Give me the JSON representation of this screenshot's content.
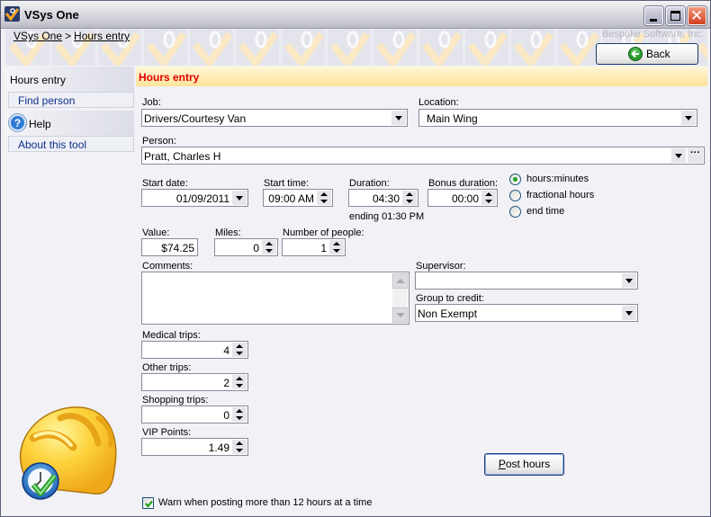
{
  "window": {
    "title": "VSys One",
    "controls": [
      "minimize",
      "maximize",
      "close"
    ]
  },
  "banner": {
    "breadcrumb": [
      {
        "label": "VSys One"
      },
      {
        "label": "Hours entry"
      }
    ],
    "breadcrumb_separator": ">",
    "company": "Bespoke Software, Inc.",
    "back_label": "Back"
  },
  "sidebar": {
    "section1_title": "Hours entry",
    "section1_link": "Find person",
    "section2_title": "Help",
    "section2_link": "About this tool"
  },
  "section": {
    "title": "Hours entry",
    "title_color": "#e00000"
  },
  "form": {
    "job": {
      "label": "Job:",
      "value": "Drivers/Courtesy Van"
    },
    "location": {
      "label": "Location:",
      "value": "Main Wing"
    },
    "person": {
      "label": "Person:",
      "value": "Pratt, Charles H"
    },
    "start_date": {
      "label": "Start date:",
      "value": "01/09/2011"
    },
    "start_time": {
      "label": "Start time:",
      "value": "09:00 AM"
    },
    "duration": {
      "label": "Duration:",
      "value": "04:30",
      "ending": "ending 01:30 PM"
    },
    "bonus_duration": {
      "label": "Bonus duration:",
      "value": "00:00"
    },
    "duration_format": {
      "options": [
        "hours:minutes",
        "fractional hours",
        "end time"
      ],
      "selected": "hours:minutes"
    },
    "value": {
      "label": "Value:",
      "value": "$74.25"
    },
    "miles": {
      "label": "Miles:",
      "value": "0"
    },
    "people": {
      "label": "Number of people:",
      "value": "1"
    },
    "comments": {
      "label": "Comments:",
      "value": ""
    },
    "supervisor": {
      "label": "Supervisor:",
      "value": ""
    },
    "group": {
      "label": "Group to credit:",
      "value": "Non Exempt"
    },
    "medical_trips": {
      "label": "Medical trips:",
      "value": "4"
    },
    "other_trips": {
      "label": "Other trips:",
      "value": "2"
    },
    "shopping_trips": {
      "label": "Shopping trips:",
      "value": "0"
    },
    "vip_points": {
      "label": "VIP Points:",
      "value": "1.49"
    },
    "post_button": {
      "mnemonic": "P",
      "rest": "ost hours"
    },
    "warn_checkbox": {
      "label": "Warn when posting more than 12 hours at a time",
      "checked": true
    }
  }
}
